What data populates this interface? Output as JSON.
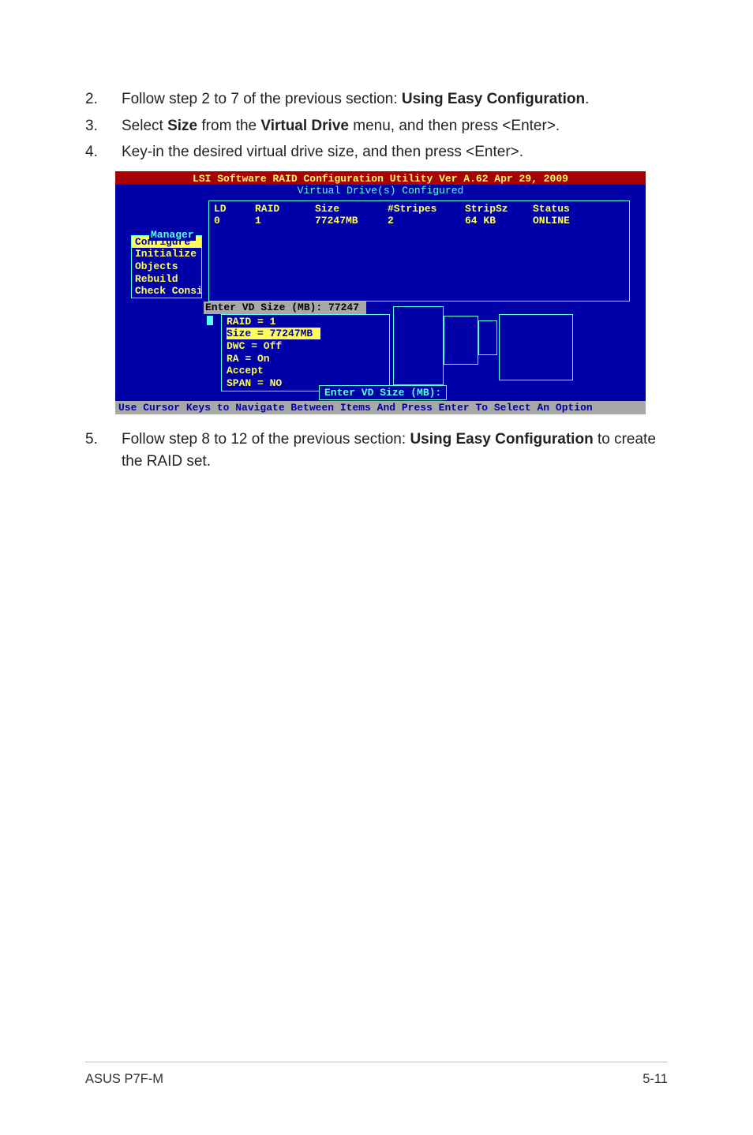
{
  "steps": {
    "s2": {
      "num": "2.",
      "pre": "Follow step 2 to 7 of the previous section: ",
      "bold": "Using Easy Configuration",
      "post": "."
    },
    "s3": {
      "num": "3.",
      "pre": "Select ",
      "b1": "Size",
      "mid": " from the ",
      "b2": "Virtual Drive",
      "post": " menu, and then press <Enter>."
    },
    "s4": {
      "num": "4.",
      "text": "Key-in the desired virtual drive size, and then press <Enter>."
    },
    "s5": {
      "num": "5.",
      "pre": "Follow step 8 to 12 of the previous section: ",
      "bold": "Using Easy Configuration",
      "post": " to create the RAID set."
    }
  },
  "bios": {
    "title": "LSI Software RAID Configuration Utility Ver A.62 Apr 29, 2009",
    "subtitle": "Virtual Drive(s) Configured",
    "cols": {
      "LD": "LD",
      "RAID": "RAID",
      "Size": "Size",
      "Stripes": "#Stripes",
      "StripSz": "StripSz",
      "Status": "Status"
    },
    "row": {
      "LD": "0",
      "RAID": "1",
      "Size": "77247MB",
      "Stripes": "2",
      "StripSz": "64 KB",
      "Status": "ONLINE"
    },
    "mgmt_label": "Management Menu",
    "mgmt": [
      "Configure",
      "Initialize",
      "Objects",
      "Rebuild",
      "Check Consistency"
    ],
    "mgmt_labels": {
      "i0": "Configure",
      "i1": "Initialize",
      "i2": "Objects",
      "i3": "Rebuild",
      "i4": "Check Consistency"
    },
    "enter_label": "Enter VD Size (MB): 77247",
    "props": {
      "raid": "RAID = 1",
      "size": "Size = 77247MB",
      "dwc": "DWC  = Off",
      "ra": "RA   = On",
      "accept": "Accept",
      "span": "SPAN = NO"
    },
    "status_box": "Enter VD Size (MB):",
    "help": "Use Cursor Keys to Navigate Between Items And Press Enter To Select An Option"
  },
  "footer": {
    "left": "ASUS P7F-M",
    "right": "5-11"
  }
}
